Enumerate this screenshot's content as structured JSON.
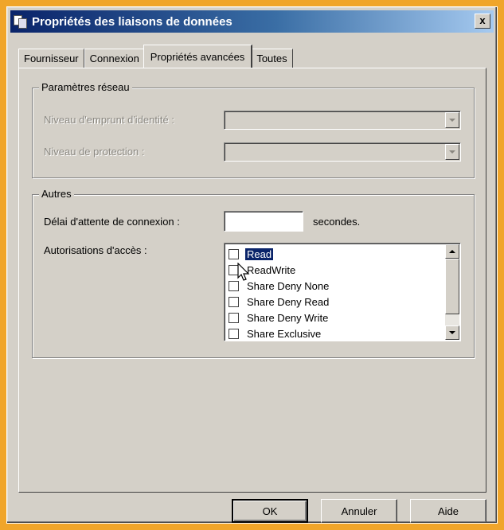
{
  "window": {
    "title": "Propriétés des liaisons de données",
    "close_label": "x"
  },
  "tabs": [
    {
      "label": "Fournisseur"
    },
    {
      "label": "Connexion"
    },
    {
      "label": "Propriétés avancées",
      "active": true
    },
    {
      "label": "Toutes"
    }
  ],
  "network_group": {
    "title": "Paramètres réseau",
    "impersonation_label": "Niveau d'emprunt d'identité :",
    "impersonation_value": "",
    "protection_label": "Niveau de protection :",
    "protection_value": ""
  },
  "other_group": {
    "title": "Autres",
    "timeout_label": "Délai d'attente de connexion :",
    "timeout_value": "",
    "timeout_unit": "secondes.",
    "access_label": "Autorisations d'accès :",
    "access_items": [
      {
        "label": "Read",
        "checked": false,
        "selected": true
      },
      {
        "label": "ReadWrite",
        "checked": false,
        "selected": false
      },
      {
        "label": "Share Deny None",
        "checked": false,
        "selected": false
      },
      {
        "label": "Share Deny Read",
        "checked": false,
        "selected": false
      },
      {
        "label": "Share Deny Write",
        "checked": false,
        "selected": false
      },
      {
        "label": "Share Exclusive",
        "checked": false,
        "selected": false
      }
    ]
  },
  "buttons": {
    "ok": "OK",
    "cancel": "Annuler",
    "help": "Aide"
  },
  "colors": {
    "frame_background": "#f0a52a",
    "titlebar_start": "#0a246a",
    "dialog_face": "#d4d0c8",
    "selection": "#0a246a"
  },
  "icons": {
    "title": "data-link-icon",
    "close": "close-icon",
    "combo": "chevron-down-icon",
    "scroll_up": "scroll-up-icon",
    "scroll_down": "scroll-down-icon",
    "cursor": "mouse-cursor-icon"
  }
}
